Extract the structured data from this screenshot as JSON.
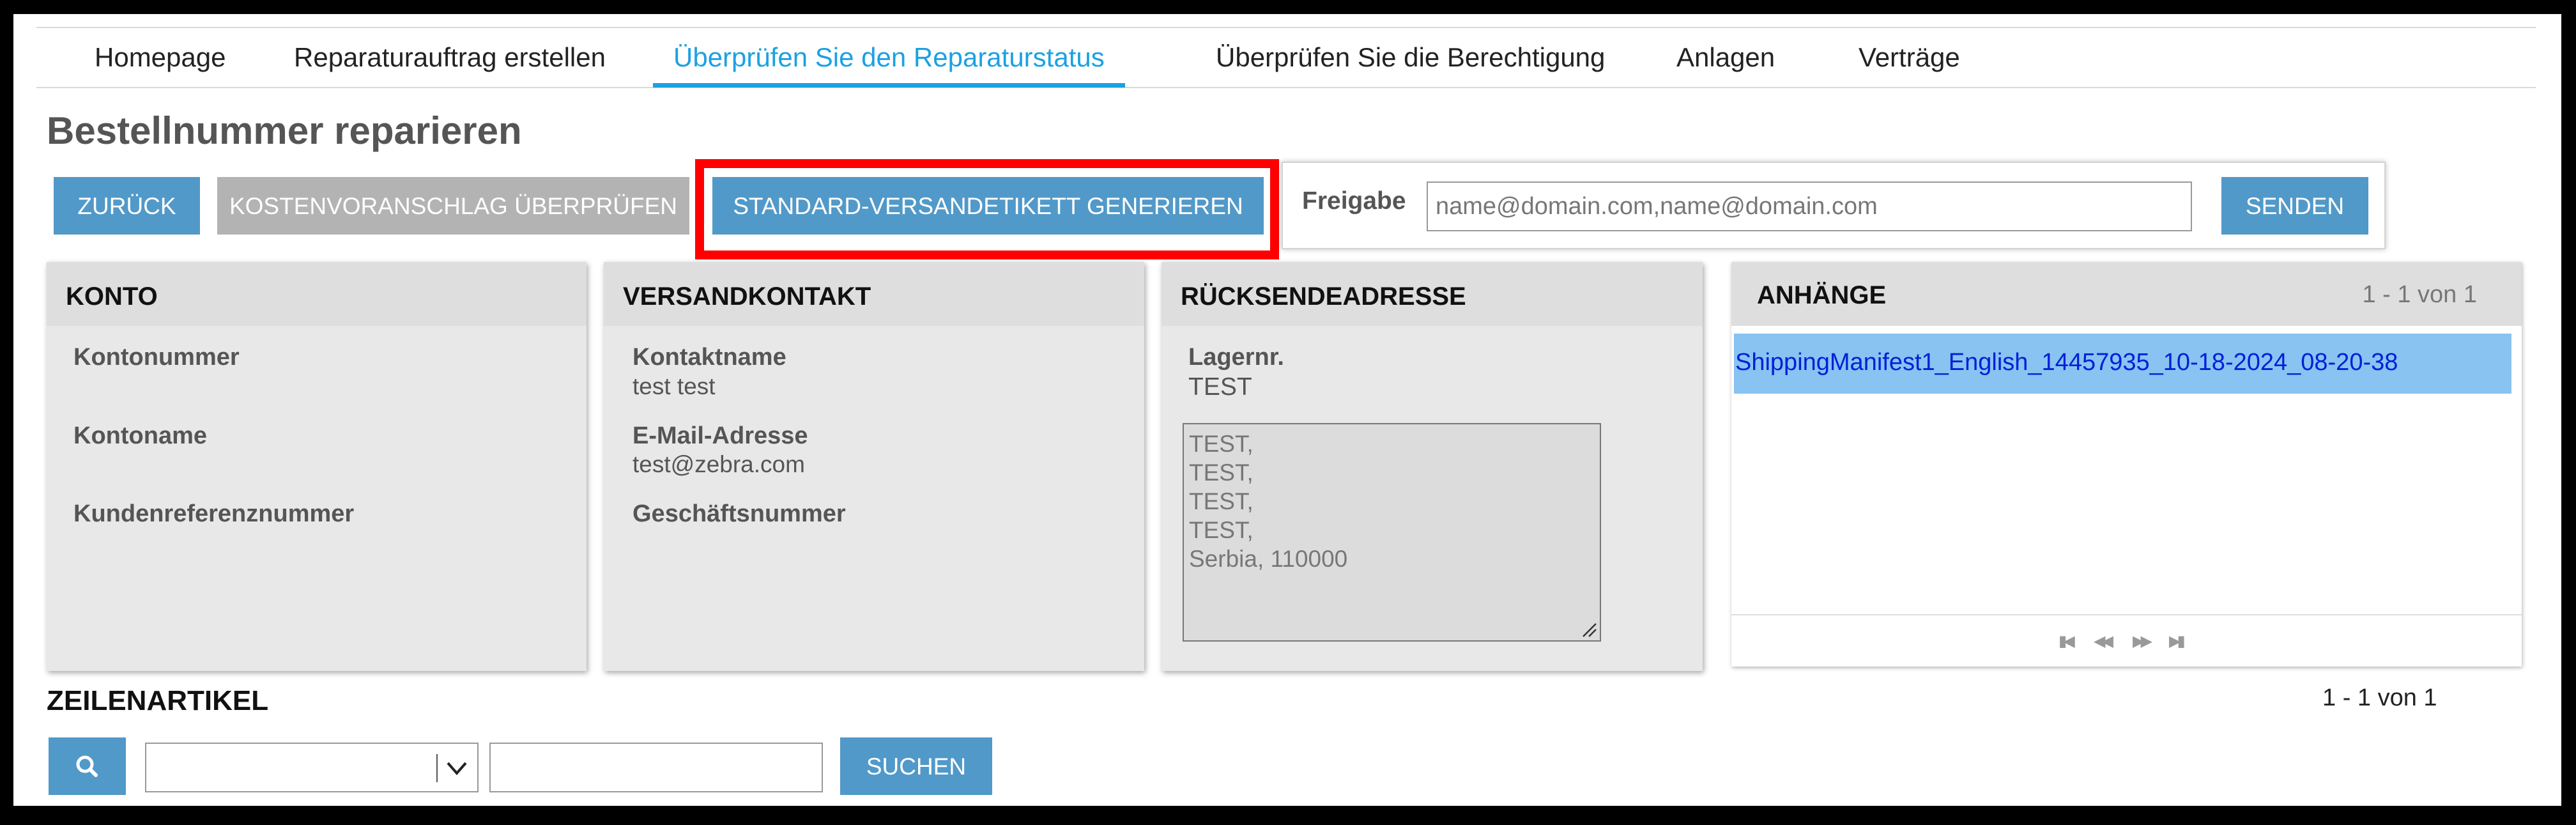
{
  "nav": {
    "items": [
      {
        "label": "Homepage"
      },
      {
        "label": "Reparaturauftrag erstellen"
      },
      {
        "label": "Überprüfen Sie den Reparaturstatus"
      },
      {
        "label": "Überprüfen Sie die Berechtigung"
      },
      {
        "label": "Anlagen"
      },
      {
        "label": "Verträge"
      }
    ],
    "active_index": 2
  },
  "page_title": "Bestellnummer reparieren",
  "actions": {
    "back": "ZURÜCK",
    "review_quote": "KOSTENVORANSCHLAG ÜBERPRÜFEN",
    "generate_label": "STANDARD-VERSANDETIKETT GENERIEREN"
  },
  "share": {
    "label": "Freigabe",
    "placeholder": "name@domain.com,name@domain.com",
    "value": "",
    "send": "SENDEN"
  },
  "account": {
    "title": "KONTO",
    "fields": [
      {
        "label": "Kontonummer",
        "value": ""
      },
      {
        "label": "Kontoname",
        "value": ""
      },
      {
        "label": "Kundenreferenznummer",
        "value": ""
      }
    ]
  },
  "shipping_contact": {
    "title": "VERSANDKONTAKT",
    "fields": [
      {
        "label": "Kontaktname",
        "value": "test test"
      },
      {
        "label": "E-Mail-Adresse",
        "value": "test@zebra.com"
      },
      {
        "label": "Geschäftsnummer",
        "value": ""
      }
    ]
  },
  "return_address": {
    "title": "RÜCKSENDEADRESSE",
    "warehouse_label": "Lagernr.",
    "warehouse_value": "TEST",
    "address_lines": [
      "TEST,",
      "TEST,",
      "TEST,",
      "TEST,",
      "Serbia, 110000"
    ]
  },
  "attachments": {
    "title": "ANHÄNGE",
    "count": "1 - 1 von 1",
    "items": [
      {
        "name": "ShippingManifest1_English_14457935_10-18-2024_08-20-38"
      }
    ],
    "pager": {
      "first": "first-page-icon",
      "prev": "prev-page-icon",
      "next": "next-page-icon",
      "last": "last-page-icon"
    }
  },
  "line_items": {
    "title": "ZEILENARTIKEL",
    "count": "1 - 1 von 1",
    "search_button": "SUCHEN",
    "select_value": "",
    "search_value": ""
  },
  "colors": {
    "accent": "#1ba1e2",
    "button_blue": "#5199c9",
    "button_grey": "#b3b3b3",
    "highlight": "#ff0000",
    "selected_row": "#88c3f2",
    "link": "#0020d8"
  }
}
